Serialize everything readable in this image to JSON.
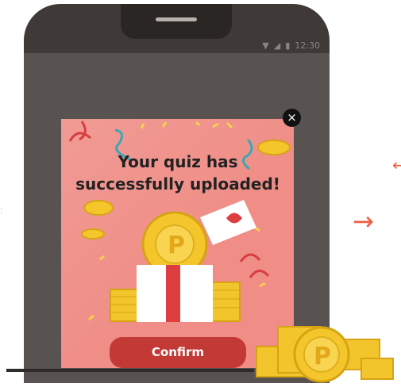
{
  "status_bar": {
    "time": "12:30",
    "wifi_icon": "wifi-icon",
    "signal_icon": "signal-icon",
    "battery_icon": "battery-icon"
  },
  "app_bar": {
    "menu_icon": "menu-icon"
  },
  "popup": {
    "title_line1": "Your quiz has",
    "title_line2": "successfully uploaded!",
    "confirm_label": "Confirm",
    "close_icon": "close-icon",
    "coin_symbol": "P"
  },
  "background": {
    "arrow_icon": "right-arrow-icon",
    "coin_stack_symbol": "P"
  },
  "colors": {
    "phone_body": "#3f3a38",
    "popup_background": "#ef8d86",
    "confirm_button": "#c33936",
    "accent_arrow": "#f05d45",
    "coin_gold": "#f5c62c",
    "ribbon": "#df3e40"
  }
}
